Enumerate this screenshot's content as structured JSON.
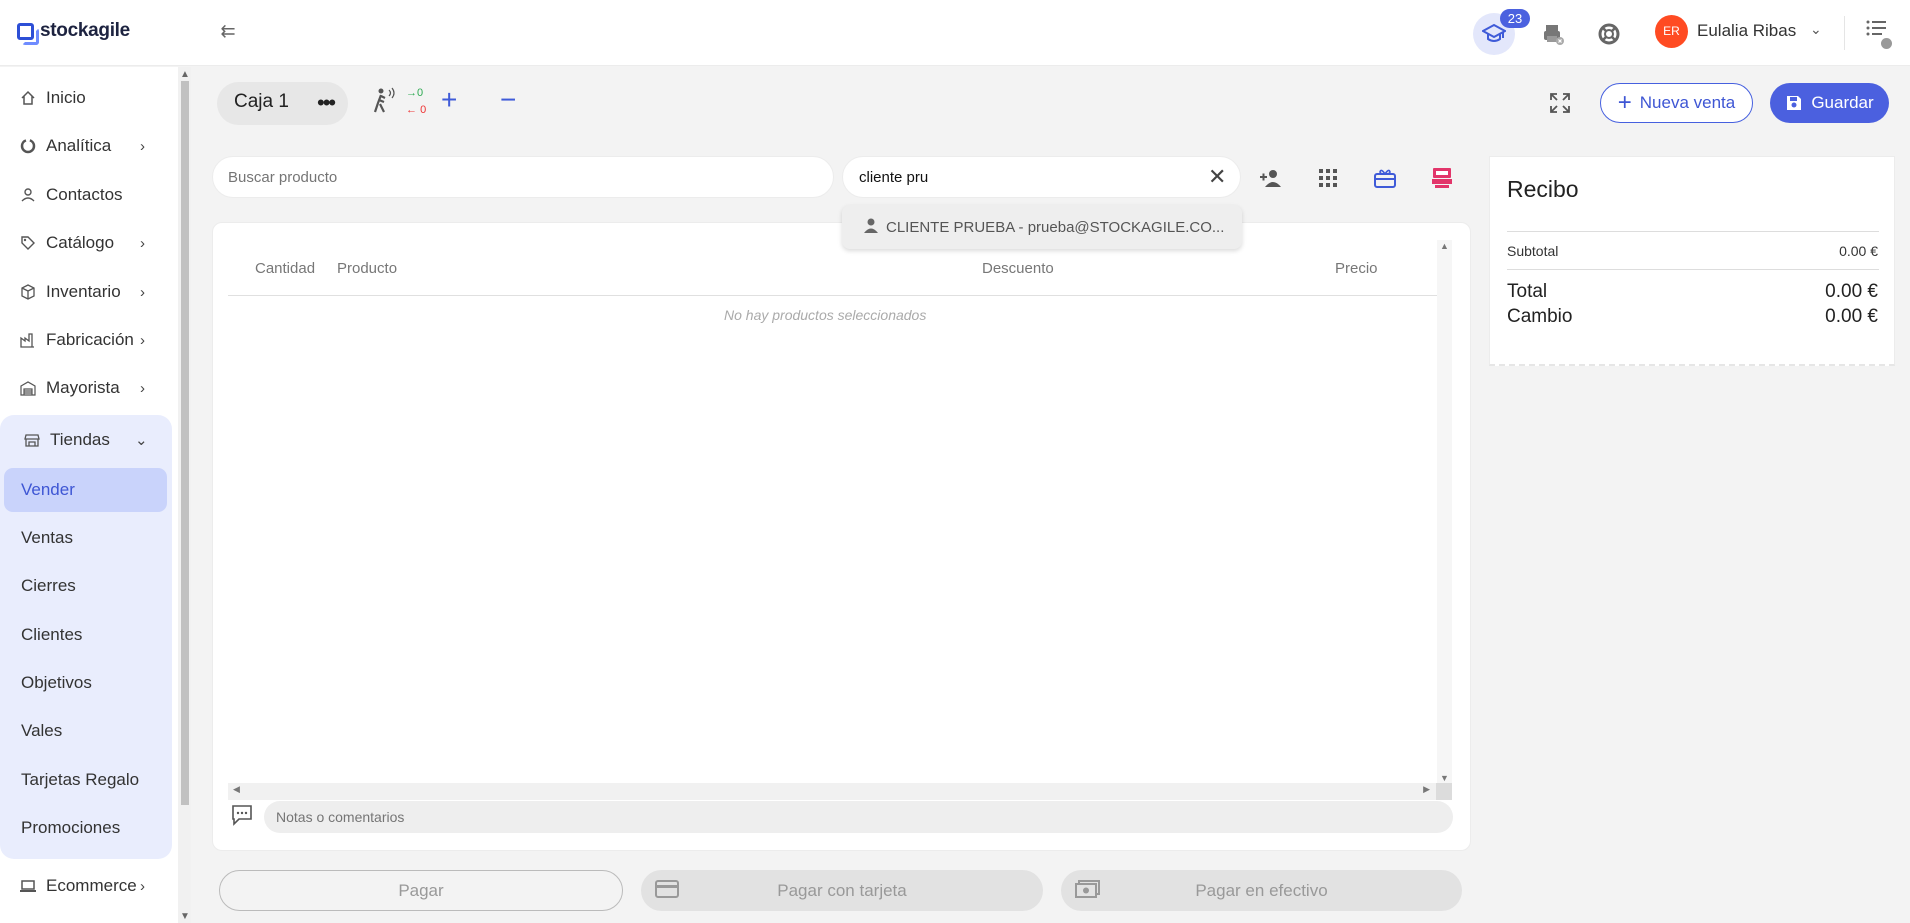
{
  "colors": {
    "accent": "#4b60df",
    "accent_light": "#e9edfd",
    "active_item": "#c9d3fb",
    "avatar": "#ff4b22",
    "in_count": "#2eaa52",
    "out_count": "#e33333"
  },
  "header": {
    "brand": "stockagile",
    "academy_badge": "23",
    "user": {
      "initials": "ER",
      "name": "Eulalia Ribas"
    }
  },
  "sidebar": {
    "items": [
      {
        "label": "Inicio",
        "icon": "home-icon"
      },
      {
        "label": "Analítica",
        "icon": "analytics-icon",
        "expandable": true
      },
      {
        "label": "Contactos",
        "icon": "person-icon"
      },
      {
        "label": "Catálogo",
        "icon": "tag-icon",
        "expandable": true
      },
      {
        "label": "Inventario",
        "icon": "box-icon",
        "expandable": true
      },
      {
        "label": "Fabricación",
        "icon": "factory-icon",
        "expandable": true
      },
      {
        "label": "Mayorista",
        "icon": "warehouse-icon",
        "expandable": true
      }
    ],
    "tiendas": {
      "label": "Tiendas",
      "icon": "store-icon",
      "subitems": [
        "Vender",
        "Ventas",
        "Cierres",
        "Clientes",
        "Objetivos",
        "Vales",
        "Tarjetas Regalo",
        "Promociones"
      ],
      "active": "Vender"
    },
    "ecommerce": {
      "label": "Ecommerce",
      "icon": "laptop-icon"
    }
  },
  "pos": {
    "register": "Caja 1",
    "visitors_in": "0",
    "visitors_out": "0",
    "new_sale_label": "Nueva venta",
    "save_label": "Guardar"
  },
  "search": {
    "product_placeholder": "Buscar producto",
    "client_value": "cliente pru",
    "suggestion": "CLIENTE PRUEBA - prueba@STOCKAGILE.CO..."
  },
  "cart": {
    "columns": [
      "Cantidad",
      "Producto",
      "Descuento",
      "Precio"
    ],
    "empty_message": "No hay productos seleccionados",
    "notes_placeholder": "Notas o comentarios"
  },
  "payment": {
    "pay_label": "Pagar",
    "card_label": "Pagar con tarjeta",
    "cash_label": "Pagar en efectivo"
  },
  "receipt": {
    "title": "Recibo",
    "subtotal_label": "Subtotal",
    "subtotal_value": "0.00 €",
    "total_label": "Total",
    "total_value": "0.00 €",
    "change_label": "Cambio",
    "change_value": "0.00 €"
  }
}
